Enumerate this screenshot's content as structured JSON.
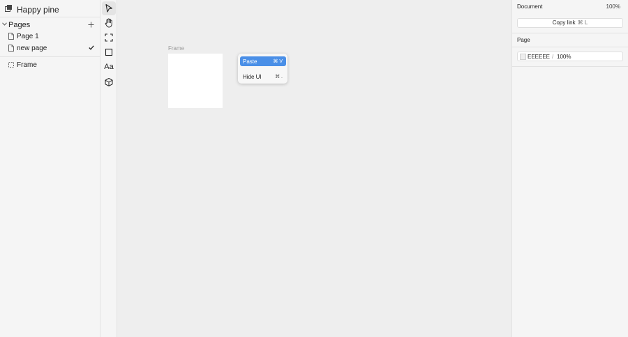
{
  "project": {
    "name": "Happy pine",
    "icon": "project-icon"
  },
  "pages": {
    "label": "Pages",
    "add_icon": "plus-icon",
    "items": [
      {
        "label": "Page 1",
        "icon": "page-icon",
        "selected": false
      },
      {
        "label": "new page",
        "icon": "page-icon",
        "selected": true
      }
    ]
  },
  "layers": [
    {
      "label": "Frame",
      "icon": "frame-icon"
    }
  ],
  "toolbar": {
    "tools": [
      {
        "name": "select-tool",
        "icon": "cursor-icon",
        "active": true
      },
      {
        "name": "hand-tool",
        "icon": "hand-icon",
        "active": false
      },
      {
        "name": "frame-tool",
        "icon": "frame-corners-icon",
        "active": false
      },
      {
        "name": "rectangle-tool",
        "icon": "square-icon",
        "active": false
      },
      {
        "name": "text-tool",
        "icon": "text-icon",
        "label": "Aa",
        "active": false
      },
      {
        "name": "component-tool",
        "icon": "cube-icon",
        "active": false
      }
    ]
  },
  "canvas": {
    "frame_label": "Frame",
    "frame_fill": "#ffffff",
    "background": "#eeeeee"
  },
  "context_menu": {
    "items": [
      {
        "label": "Paste",
        "shortcut": "⌘ V",
        "highlighted": true
      },
      {
        "label": "Hide UI",
        "shortcut": "⌘ .",
        "highlighted": false
      }
    ],
    "highlight_color": "#4a8fe7"
  },
  "right_panel": {
    "document_title": "Document",
    "zoom": "100%",
    "copy_link": {
      "label": "Copy link",
      "shortcut": "⌘ L"
    },
    "page_section": {
      "title": "Page",
      "color_hex": "EEEEEE",
      "separator": "/",
      "opacity": "100%"
    }
  }
}
